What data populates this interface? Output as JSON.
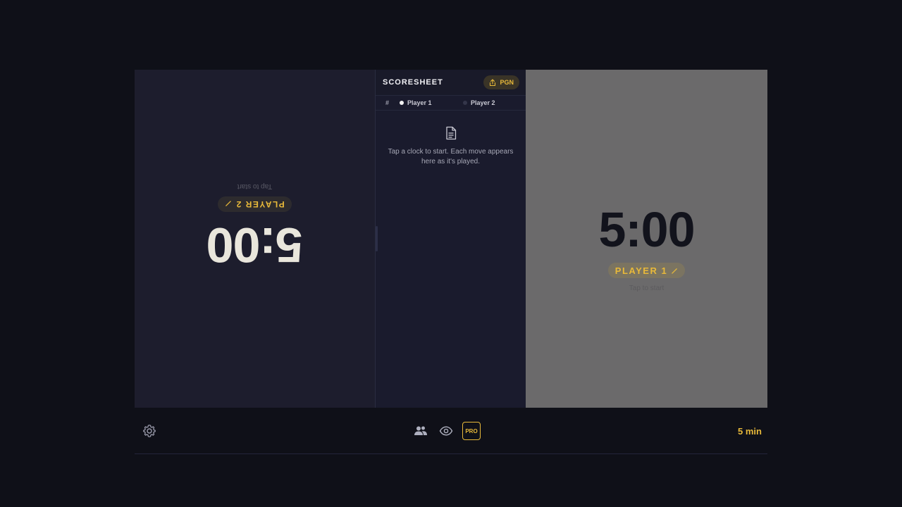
{
  "player2_clock": {
    "time": "5:00",
    "player_label": "PLAYER 2",
    "hint": "Tap to start"
  },
  "player1_clock": {
    "time": "5:00",
    "player_label": "PLAYER 1",
    "hint": "Tap to start"
  },
  "scoresheet": {
    "title": "SCORESHEET",
    "export_label": "PGN",
    "columns": {
      "number": "#",
      "player1": "Player 1",
      "player2": "Player 2"
    },
    "empty_message": "Tap a clock to start. Each move appears here as it's played."
  },
  "toolbar": {
    "pro_label": "PRO",
    "time_control": "5 min"
  },
  "colors": {
    "accent": "#e8b93a",
    "active_clock_bg": "#6b6a6b",
    "inactive_clock_bg": "#1d1d2d"
  },
  "icons": {
    "settings": "gear-icon",
    "players": "users-icon",
    "spectate": "eye-icon",
    "export": "share-icon",
    "empty_sheet": "document-icon",
    "edit": "pencil-icon"
  }
}
